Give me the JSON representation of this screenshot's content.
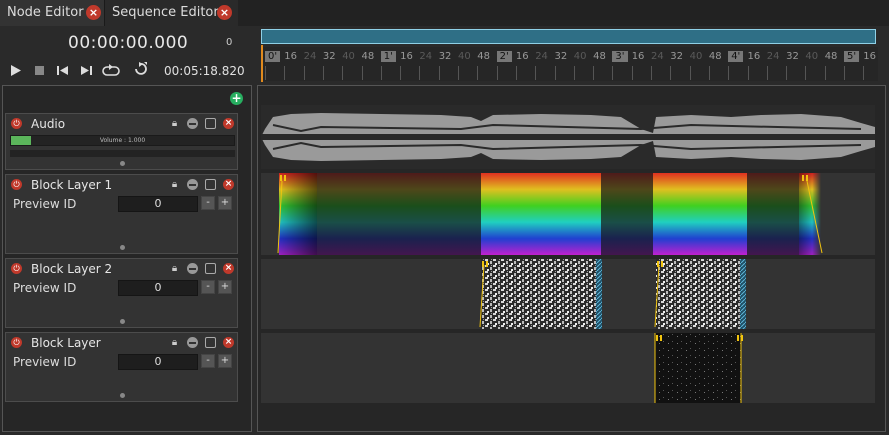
{
  "tabs": [
    {
      "label": "Node Editor",
      "active": false
    },
    {
      "label": "Sequence Editor",
      "active": true
    }
  ],
  "transport": {
    "timecode": "00:00:00.000",
    "frame": "0",
    "duration": "00:05:18.820",
    "buttons": [
      "play-icon",
      "stop-icon",
      "skip-back-icon",
      "skip-forward-icon",
      "loop-icon",
      "sync-icon"
    ]
  },
  "ruler": {
    "labels": [
      "0'",
      "16",
      "24",
      "32",
      "40",
      "48",
      "1'",
      "16",
      "24",
      "32",
      "40",
      "48",
      "2'",
      "16",
      "24",
      "32",
      "40",
      "48",
      "3'",
      "16",
      "24",
      "32",
      "40",
      "48",
      "4'",
      "16",
      "24",
      "32",
      "40",
      "48",
      "5'",
      "16"
    ],
    "label_style": [
      "maj",
      "min",
      "dim",
      "min",
      "dim",
      "min",
      "maj",
      "min",
      "dim",
      "min",
      "dim",
      "min",
      "maj",
      "min",
      "dim",
      "min",
      "dim",
      "min",
      "maj",
      "min",
      "dim",
      "min",
      "dim",
      "min",
      "maj",
      "min",
      "dim",
      "min",
      "dim",
      "min",
      "maj",
      "min"
    ]
  },
  "layers": [
    {
      "name": "Audio",
      "type": "audio",
      "volume_label": "Volume : 1.000",
      "volume_fraction": 0.09
    },
    {
      "name": "Block Layer 1",
      "type": "block",
      "preview_label": "Preview ID",
      "preview_value": "0"
    },
    {
      "name": "Block Layer 2",
      "type": "block",
      "preview_label": "Preview ID",
      "preview_value": "0"
    },
    {
      "name": "Block Layer",
      "type": "block",
      "preview_label": "Preview ID",
      "preview_value": "0"
    }
  ],
  "stepper": {
    "minus": "-",
    "plus": "+"
  },
  "colors": {
    "accent": "#2f6f86",
    "power": "#c0392b",
    "add": "#27ae60",
    "playhead": "#e08a1e",
    "clip_marker": "#f1c40f",
    "clip_edge": "#5fb6d8"
  }
}
